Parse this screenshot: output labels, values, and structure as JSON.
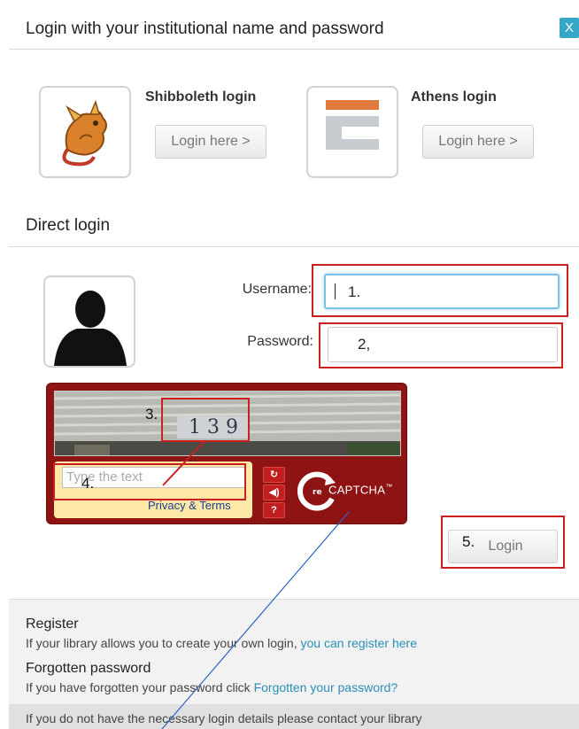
{
  "header": {
    "title": "Login with your institutional name and password",
    "close_label": "X"
  },
  "providers": [
    {
      "name": "Shibboleth login",
      "button_label": "Login here >"
    },
    {
      "name": "Athens login",
      "button_label": "Login here >"
    }
  ],
  "direct_login": {
    "title": "Direct login",
    "username_label": "Username:",
    "password_label": "Password:"
  },
  "captcha": {
    "challenge_text": "1 3 9",
    "input_placeholder": "Type the text",
    "privacy_label": "Privacy & Terms",
    "logo_text": "CAPTCHA",
    "logo_prefix": "re",
    "trademark": "™",
    "refresh_icon": "↻",
    "audio_icon": "◀)",
    "help_icon": "?"
  },
  "annotations": {
    "a1": "1.",
    "a2": "2,",
    "a3": "3.",
    "a4": "4.",
    "a5": "5."
  },
  "login_button": {
    "label": "Login"
  },
  "footer": {
    "register_title": "Register",
    "register_text": "If your library allows you to create your own login, ",
    "register_link": "you can register here",
    "forgot_title": "Forgotten password",
    "forgot_text": "If you have forgotten your password click ",
    "forgot_link": "Forgotten your password?",
    "contact_text": "If you do not have the necessary login details please contact your library"
  },
  "colors": {
    "accent": "#35a7c9",
    "captcha_bg": "#8e1414",
    "annotation_red": "#cc1f1f",
    "link": "#2a8fb7"
  }
}
